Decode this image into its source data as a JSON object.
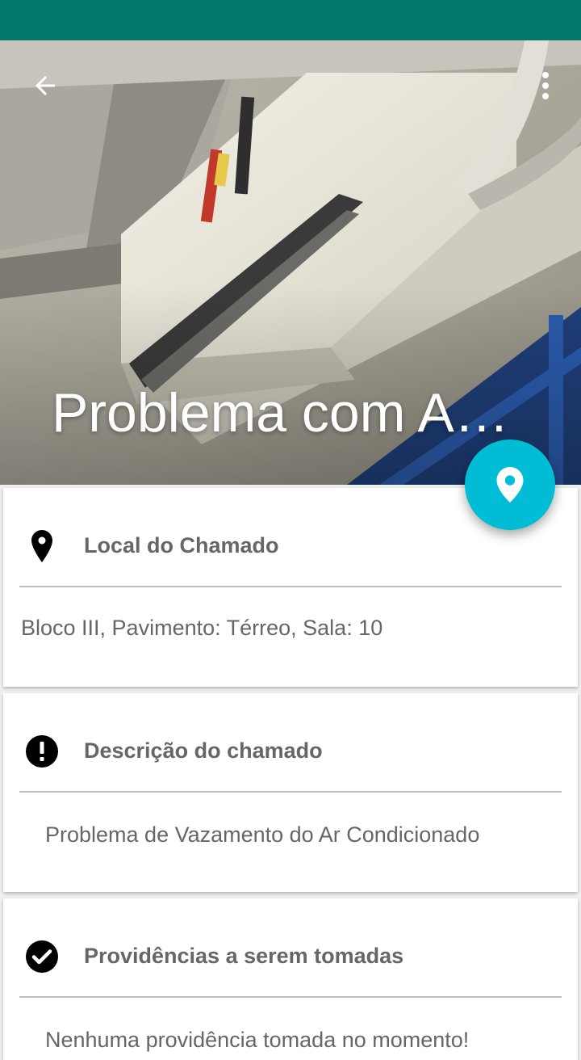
{
  "header": {
    "title": "Problema com Ar Condicionado",
    "photo_icon": "air-conditioner-photo",
    "back_icon": "arrow-back-icon",
    "menu_icon": "more-vert-icon"
  },
  "fab": {
    "icon": "location-pin-icon",
    "color": "#00bcd4"
  },
  "colors": {
    "status_bar": "#00796b",
    "accent": "#00bcd4"
  },
  "cards": {
    "local": {
      "heading": "Local do Chamado",
      "icon": "location-pin-icon",
      "body": "Bloco III, Pavimento: Térreo, Sala: 10"
    },
    "description": {
      "heading": "Descrição do chamado",
      "icon": "alert-circle-icon",
      "body": "Problema de Vazamento do Ar Condicionado"
    },
    "actions": {
      "heading": "Providências a serem tomadas",
      "icon": "check-circle-icon",
      "body": "Nenhuma providência tomada no momento!"
    }
  }
}
